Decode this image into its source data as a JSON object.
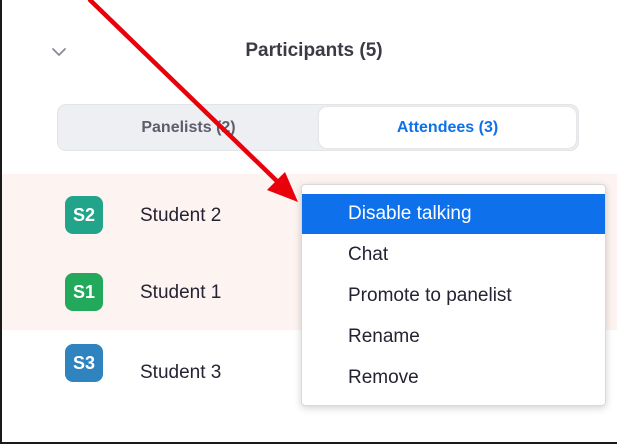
{
  "panel": {
    "title": "Participants (5)"
  },
  "tabs": [
    {
      "label": "Panelists (2)",
      "selected": false
    },
    {
      "label": "Attendees (3)",
      "selected": true
    }
  ],
  "attendees": [
    {
      "initials": "S2",
      "name": "Student 2",
      "avatar_color": "#21a489"
    },
    {
      "initials": "S1",
      "name": "Student 1",
      "avatar_color": "#22a95c"
    },
    {
      "initials": "S3",
      "name": "Student 3",
      "avatar_color": "#2f83be"
    }
  ],
  "context_menu": {
    "items": [
      {
        "label": "Disable talking",
        "highlighted": true
      },
      {
        "label": "Chat",
        "highlighted": false
      },
      {
        "label": "Promote to panelist",
        "highlighted": false
      },
      {
        "label": "Rename",
        "highlighted": false
      },
      {
        "label": "Remove",
        "highlighted": false
      }
    ]
  },
  "colors": {
    "accent": "#0e71eb",
    "row_highlight": "#fdf3f0",
    "annotation_arrow": "#e8000b"
  },
  "icons": {
    "collapse": "chevron-down-icon"
  }
}
